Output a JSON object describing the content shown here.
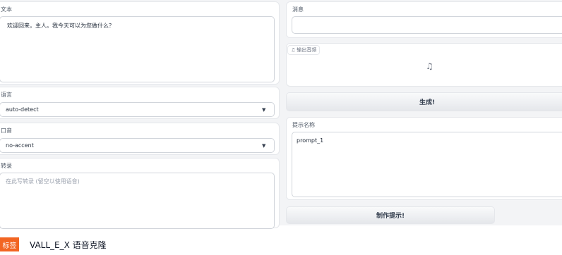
{
  "left": {
    "text_label": "文本",
    "text_value": "欢迎回来，主人。我今天可以为您做什么？",
    "language_label": "语言",
    "language_value": "auto-detect",
    "accent_label": "口音",
    "accent_value": "no-accent",
    "transcript_label": "转录",
    "transcript_placeholder": "在此写转录 (留空以使用语音)"
  },
  "right": {
    "message_label": "消息",
    "message_value": "",
    "audio_label": "输出音频",
    "generate_button": "生成!",
    "prompt_name_label": "提示名称",
    "prompt_name_value": "prompt_1",
    "make_prompt_button": "制作提示!"
  },
  "footer": {
    "badge": "标签",
    "title": "VALL_E_X  语音克隆"
  },
  "icons": {
    "music": "music-note-icon",
    "dropdown": "caret-down-icon"
  },
  "colors": {
    "badge": "#f26522",
    "page_background": "#f3f4f6"
  }
}
